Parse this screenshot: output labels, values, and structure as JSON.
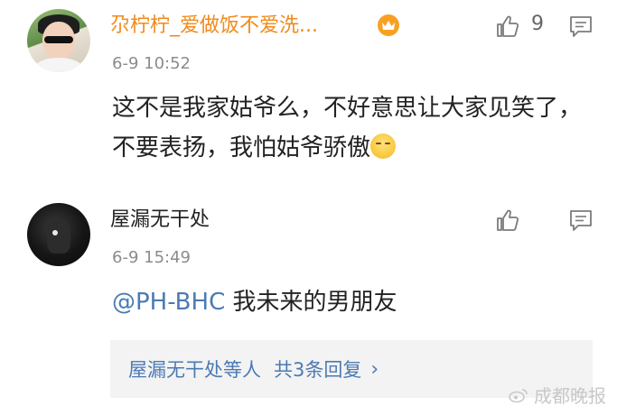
{
  "comments": [
    {
      "name": "尕柠柠_爱做饭不爱洗...",
      "time": "6-9 10:52",
      "text": "这不是我家姑爷么，不好意思让大家见笑了，不要表扬，我怕姑爷骄傲",
      "likes": "9",
      "badge_icon": "crown-icon",
      "name_color": "#f08a1a"
    },
    {
      "name": "屋漏无干处",
      "time": "6-9 15:49",
      "mention": "@PH-BHC",
      "text": " 我未来的男朋友",
      "replies": {
        "who": "屋漏无干处等人",
        "count": "共3条回复",
        "chevron": "›"
      }
    }
  ],
  "watermark": "成都晚报",
  "colors": {
    "link_blue": "#4b7ab3",
    "reply_box_bg": "#f3f3f3",
    "time_grey": "#8c8c8c"
  }
}
